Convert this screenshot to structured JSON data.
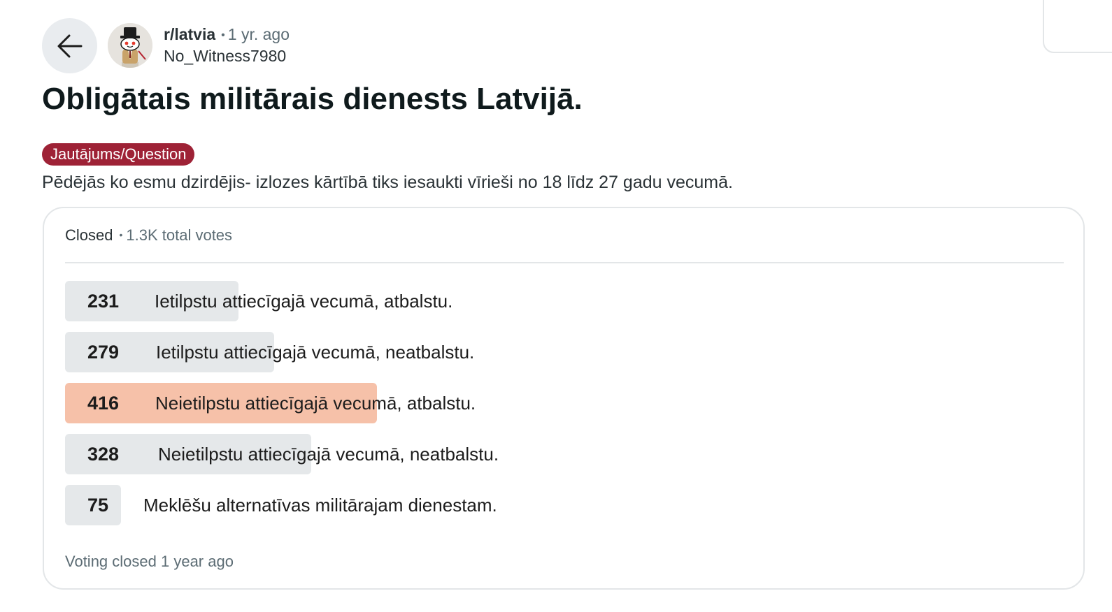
{
  "post": {
    "subreddit": "r/latvia",
    "time_ago": "1 yr. ago",
    "author": "No_Witness7980",
    "title": "Obligātais militārais dienests Latvijā.",
    "flair": "Jautājums/Question",
    "body": "Pēdējās ko esmu dzirdējis- izlozes kārtībā tiks iesaukti vīrieši no 18 līdz 27 gadu vecumā."
  },
  "icons": {
    "back": "arrow-left-icon",
    "avatar": "snoo-avatar-icon"
  },
  "poll": {
    "status": "Closed",
    "total_votes": "1.3K total votes",
    "footer": "Voting closed 1 year ago",
    "options": [
      {
        "count": "231",
        "votes": 231,
        "label": "Ietilpstu attiecīgajā vecumā, atbalstu."
      },
      {
        "count": "279",
        "votes": 279,
        "label": "Ietilpstu attiecīgajā vecumā, neatbalstu."
      },
      {
        "count": "416",
        "votes": 416,
        "label": "Neietilpstu attiecīgajā vecumā, atbalstu.",
        "winner": true
      },
      {
        "count": "328",
        "votes": 328,
        "label": "Neietilpstu attiecīgajā vecumā, neatbalstu."
      },
      {
        "count": "75",
        "votes": 75,
        "label": "Meklēšu alternatīvas militārajam dienestam."
      }
    ]
  },
  "colors": {
    "flair_bg": "#9e2236",
    "winner_bar": "#f6c1a9",
    "bar": "#e5e8ea",
    "muted_text": "#5c6c74"
  }
}
